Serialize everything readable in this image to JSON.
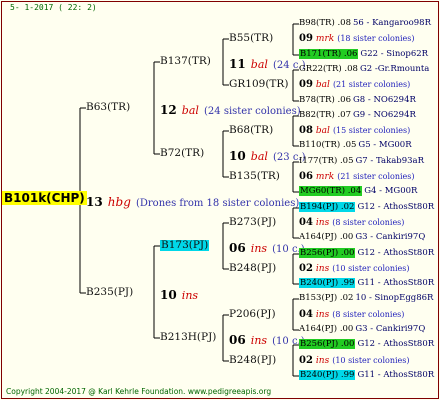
{
  "header": "5- 1-2017 ( 22: 2)",
  "footer": "Copyright 2004-2017 @ Karl Kehrle Foundation.   www.pedigreeapis.org",
  "root": {
    "label": "B101k(CHP)",
    "num": "13",
    "sym": "hbg",
    "note": "(Drones from 18 sister colonies)"
  },
  "gen1": [
    {
      "label": "B63(TR)",
      "num": "12",
      "sym": "bal",
      "note": "(24 sister colonies)"
    },
    {
      "label": "B235(PJ)",
      "num": "10",
      "sym": "ins",
      "note": ""
    }
  ],
  "gen2": [
    {
      "label": "B137(TR)",
      "num": "11",
      "sym": "bal",
      "note": "(24 c.)"
    },
    {
      "label": "B72(TR)",
      "num": "10",
      "sym": "bal",
      "note": "(23 c.)"
    },
    {
      "label": "B173(PJ)",
      "num": "06",
      "sym": "ins",
      "note": "(10 c.)"
    },
    {
      "label": "B213H(PJ)",
      "num": "06",
      "sym": "ins",
      "note": "(10 c.)"
    }
  ],
  "gen3": [
    "B55(TR)",
    "GR109(TR)",
    "B68(TR)",
    "B135(TR)",
    "B273(PJ)",
    "B248(PJ)",
    "P206(PJ)",
    "B248(PJ)"
  ],
  "gen4": [
    {
      "id": "B98(TR) .08",
      "tail": "56 - Kangaroo98R",
      "hl": ""
    },
    {
      "id": "09",
      "sym": "mrk",
      "note": "(18 sister colonies)"
    },
    {
      "id": "B171(TR) .06",
      "tail": "G22 - Sinop62R",
      "hl": "green"
    },
    {
      "id": "GR22(TR) .08",
      "tail": "G2 -Gr.Rmounta",
      "hl": ""
    },
    {
      "id": "09",
      "sym": "bal",
      "note": "(21 sister colonies)"
    },
    {
      "id": "B78(TR) .06",
      "tail": "G8 - NO6294R",
      "hl": ""
    },
    {
      "id": "B82(TR) .07",
      "tail": "G9 - NO6294R",
      "hl": ""
    },
    {
      "id": "08",
      "sym": "bal",
      "note": "(15 sister colonies)"
    },
    {
      "id": "B110(TR) .05",
      "tail": "G5 - MG00R",
      "hl": ""
    },
    {
      "id": "I177(TR) .05",
      "tail": "G7 - Takab93aR",
      "hl": ""
    },
    {
      "id": "06",
      "sym": "mrk",
      "note": "(21 sister colonies)"
    },
    {
      "id": "MG60(TR) .04",
      "tail": "G4 - MG00R",
      "hl": "green"
    },
    {
      "id": "B194(PJ) .02",
      "tail": "G12 - AthosSt80R",
      "hl": "cyan"
    },
    {
      "id": "04",
      "sym": "ins",
      "note": "(8 sister colonies)"
    },
    {
      "id": "A164(PJ) .00",
      "tail": "G3 - Cankiri97Q",
      "hl": ""
    },
    {
      "id": "B256(PJ) .00",
      "tail": "G12 - AthosSt80R",
      "hl": "green"
    },
    {
      "id": "02",
      "sym": "ins",
      "note": "(10 sister colonies)"
    },
    {
      "id": "B240(PJ) .99",
      "tail": "G11 - AthosSt80R",
      "hl": "cyan"
    },
    {
      "id": "B153(PJ) .02",
      "tail": "10 - SinopEgg86R",
      "hl": ""
    },
    {
      "id": "04",
      "sym": "ins",
      "note": "(8 sister colonies)"
    },
    {
      "id": "A164(PJ) .00",
      "tail": "G3 - Cankiri97Q",
      "hl": ""
    },
    {
      "id": "B256(PJ) .00",
      "tail": "G12 - AthosSt80R",
      "hl": "green"
    },
    {
      "id": "02",
      "sym": "ins",
      "note": "(10 sister colonies)"
    },
    {
      "id": "B240(PJ) .99",
      "tail": "G11 - AthosSt80R",
      "hl": "cyan"
    }
  ],
  "colors": {
    "line": "#000000",
    "frame": "#800000",
    "cyan": "#00d8e8",
    "green": "#22cc22",
    "root": "#ffff00"
  }
}
